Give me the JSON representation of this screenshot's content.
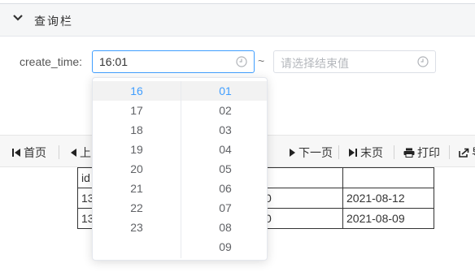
{
  "query_bar": {
    "title": "查询栏"
  },
  "filter": {
    "label": "create_time:",
    "start_value": "16:01",
    "separator": "~",
    "end_placeholder": "请选择结束值"
  },
  "toolbar": {
    "first_page": "首页",
    "prev_page": "上",
    "next_page": "下一页",
    "last_page": "末页",
    "print": "打印",
    "export": "导"
  },
  "table": {
    "rows": [
      [
        "id",
        "",
        "",
        ""
      ],
      [
        "13",
        "",
        "0",
        "2021-08-12"
      ],
      [
        "13",
        "",
        "0",
        "2021-08-09"
      ]
    ]
  },
  "time_picker": {
    "hours": [
      "16",
      "17",
      "18",
      "19",
      "20",
      "21",
      "22",
      "23"
    ],
    "minutes": [
      "01",
      "02",
      "03",
      "04",
      "05",
      "06",
      "07",
      "08",
      "09"
    ],
    "selected_hour": "16",
    "selected_minute": "01"
  },
  "colors": {
    "accent": "#409eff",
    "header_bg": "#f5f6f7",
    "toolbar_bg": "#f7f7f7"
  }
}
